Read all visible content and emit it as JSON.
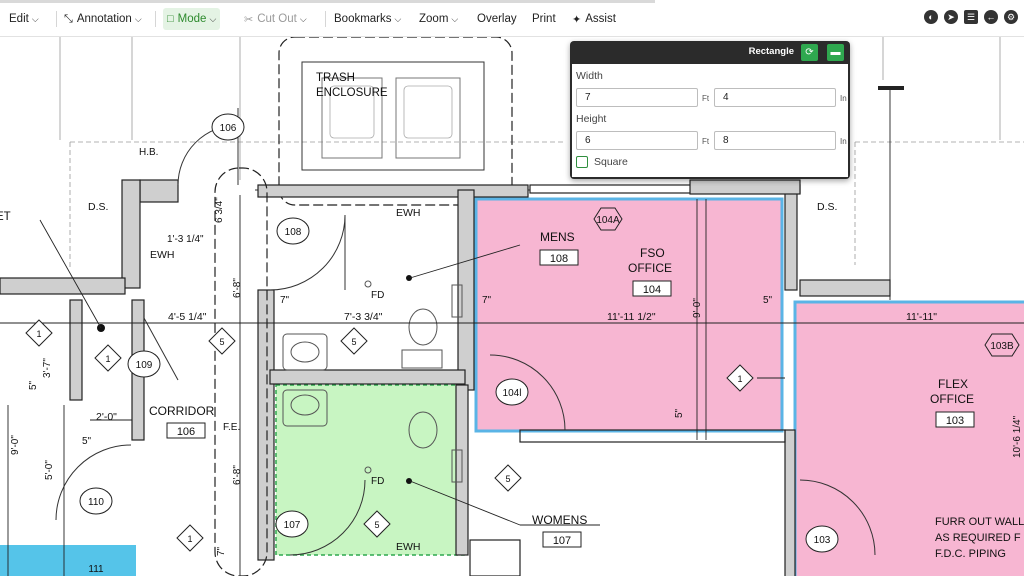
{
  "toolbar": {
    "edit": "Edit",
    "annotation": "Annotation",
    "mode": "Mode",
    "cut_out": "Cut Out",
    "bookmarks": "Bookmarks",
    "zoom": "Zoom",
    "overlay": "Overlay",
    "print": "Print",
    "assist": "Assist"
  },
  "panel": {
    "title": "Rectangle",
    "width_label": "Width",
    "height_label": "Height",
    "width_ft": "7",
    "width_in": "4",
    "height_ft": "6",
    "height_in": "8",
    "unit_ft": "Ft",
    "unit_in": "In",
    "square_label": "Square"
  },
  "colors": {
    "pink": "#f7b6d2",
    "green": "#c8f5c2",
    "cyan": "#55c4e9",
    "blue_outline": "#5ab4e6",
    "accent_green": "#2fa84f"
  },
  "plan": {
    "labels": {
      "trash_1": "TRASH",
      "trash_2": "ENCLOSURE",
      "hb": "H.B.",
      "ds_left": "D.S.",
      "ds_right": "D.S.",
      "et": "ET",
      "ewh_top": "EWH",
      "ewh_left": "EWH",
      "ewh_bottom": "EWH",
      "dim_1_3": "1'-3 1/4\"",
      "dim_6_3": "6 3/4\"",
      "dim_6_8a": "6'-8\"",
      "dim_6_8b": "6'-8\"",
      "dim_4_5": "4'-5 1/4\"",
      "dim_7_3": "7'-3 3/4\"",
      "dim_7a": "7\"",
      "dim_7b": "7\"",
      "dim_7c": "7\"",
      "dim_11_11h": "11'-11 1/2\"",
      "dim_9_0a": "9'-0\"",
      "dim_5a": "5\"",
      "dim_5b": "5\"",
      "dim_5c": "5\"",
      "dim_5d": "5\"",
      "dim_11_11": "11'-11\"",
      "dim_2_0": "2'-0\"",
      "dim_3_7": "3'-7\"",
      "dim_9_0b": "9'-0\"",
      "dim_5_0": "5'-0\"",
      "dim_10_6": "10'-6 1/4\"",
      "fd1": "FD",
      "fd2": "FD",
      "fe": "F.E.",
      "corridor": "CORRIDOR",
      "mens": "MENS",
      "fso_1": "FSO",
      "fso_2": "OFFICE",
      "flex_1": "FLEX",
      "flex_2": "OFFICE",
      "womens": "WOMENS",
      "furr_1": "FURR OUT WALL",
      "furr_2": "AS REQUIRED F",
      "furr_3": "F.D.C. PIPING"
    },
    "room_numbers": {
      "r106": "106",
      "r108": "108",
      "r104": "104",
      "r103": "103",
      "r107": "107",
      "r110": "110",
      "r109": "109",
      "r111": "111",
      "r104a": "104A",
      "r103b": "103B"
    },
    "tags": {
      "t106c": "106",
      "t108c": "108",
      "t104l": "104l",
      "t103c": "103",
      "t107c": "107",
      "t110c": "110",
      "t109c": "109",
      "d1a": "1",
      "d1b": "1",
      "d1c": "1",
      "d1d": "1",
      "d5a": "5",
      "d5b": "5",
      "d5c": "5",
      "d5d": "5"
    }
  }
}
